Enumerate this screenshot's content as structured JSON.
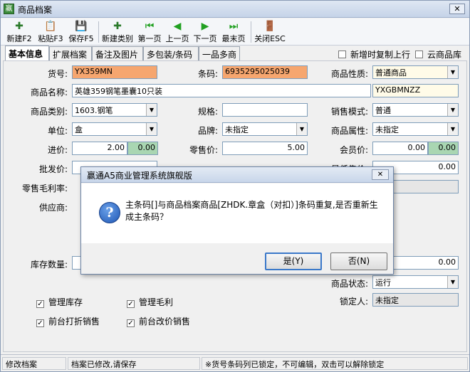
{
  "window": {
    "title": "商品档案",
    "close": "✕"
  },
  "toolbar": {
    "items": [
      {
        "label": "新建F2",
        "icon": "✚"
      },
      {
        "label": "粘贴F3",
        "icon": "📋"
      },
      {
        "label": "保存F5",
        "icon": "💾"
      },
      {
        "label": "新建类别",
        "icon": "✚"
      },
      {
        "label": "第一页",
        "icon": "⏮"
      },
      {
        "label": "上一页",
        "icon": "◀"
      },
      {
        "label": "下一页",
        "icon": "▶"
      },
      {
        "label": "最末页",
        "icon": "⏭"
      },
      {
        "label": "关闭ESC",
        "icon": "🚪"
      }
    ]
  },
  "tabs": [
    "基本信息",
    "扩展档案",
    "备注及图片",
    "多包装/条码",
    "一品多商"
  ],
  "options": {
    "copy_on_add": "新增时复制上行",
    "cloud_library": "云商品库"
  },
  "form": {
    "item_no_label": "货号:",
    "item_no": "YX359MN",
    "barcode_label": "条码:",
    "barcode": "6935295025039",
    "nature_label": "商品性质:",
    "nature": "普通商品",
    "name_label": "商品名称:",
    "name": "英雄359钢笔墨囊10只装",
    "name_code": "YXGBMNZZ",
    "category_label": "商品类别:",
    "category": "1603.钢笔",
    "spec_label": "规格:",
    "spec": "",
    "sales_mode_label": "销售模式:",
    "sales_mode": "普通",
    "unit_label": "单位:",
    "unit": "盒",
    "brand_label": "品牌:",
    "brand": "未指定",
    "attr_label": "商品属性:",
    "attr": "未指定",
    "purchase_label": "进价:",
    "purchase": "2.00",
    "purchase_extra": "0.00",
    "retail_label": "零售价:",
    "retail": "5.00",
    "member_label": "会员价:",
    "member": "0.00",
    "member_extra": "0.00",
    "wholesale_label": "批发价:",
    "min_price_label": "最低售价:",
    "min_price": "0.00",
    "margin_label": "零售毛利率:",
    "supplier_label": "供应商:",
    "stock_label": "库存数量:",
    "stock_right_value": "0.00",
    "lock_state_label": "商品状态:",
    "lock_state": "运行",
    "locker_label": "锁定人:",
    "locker": "未指定",
    "manage_stock": "管理库存",
    "manage_margin": "管理毛利",
    "front_discount": "前台打折销售",
    "front_change_price": "前台改价销售"
  },
  "status": {
    "p1": "修改档案",
    "p2": "档案已修改,请保存",
    "p3": "※货号条码列已锁定，不可编辑，双击可以解除锁定"
  },
  "dialog": {
    "title": "赢通A5商业管理系统旗舰版",
    "close": "✕",
    "message": "主条码[]与商品档案商品[ZHDK.章盒（对扣）]条码重复,是否重新生成主条码？",
    "yes": "是(Y)",
    "no": "否(N)"
  }
}
